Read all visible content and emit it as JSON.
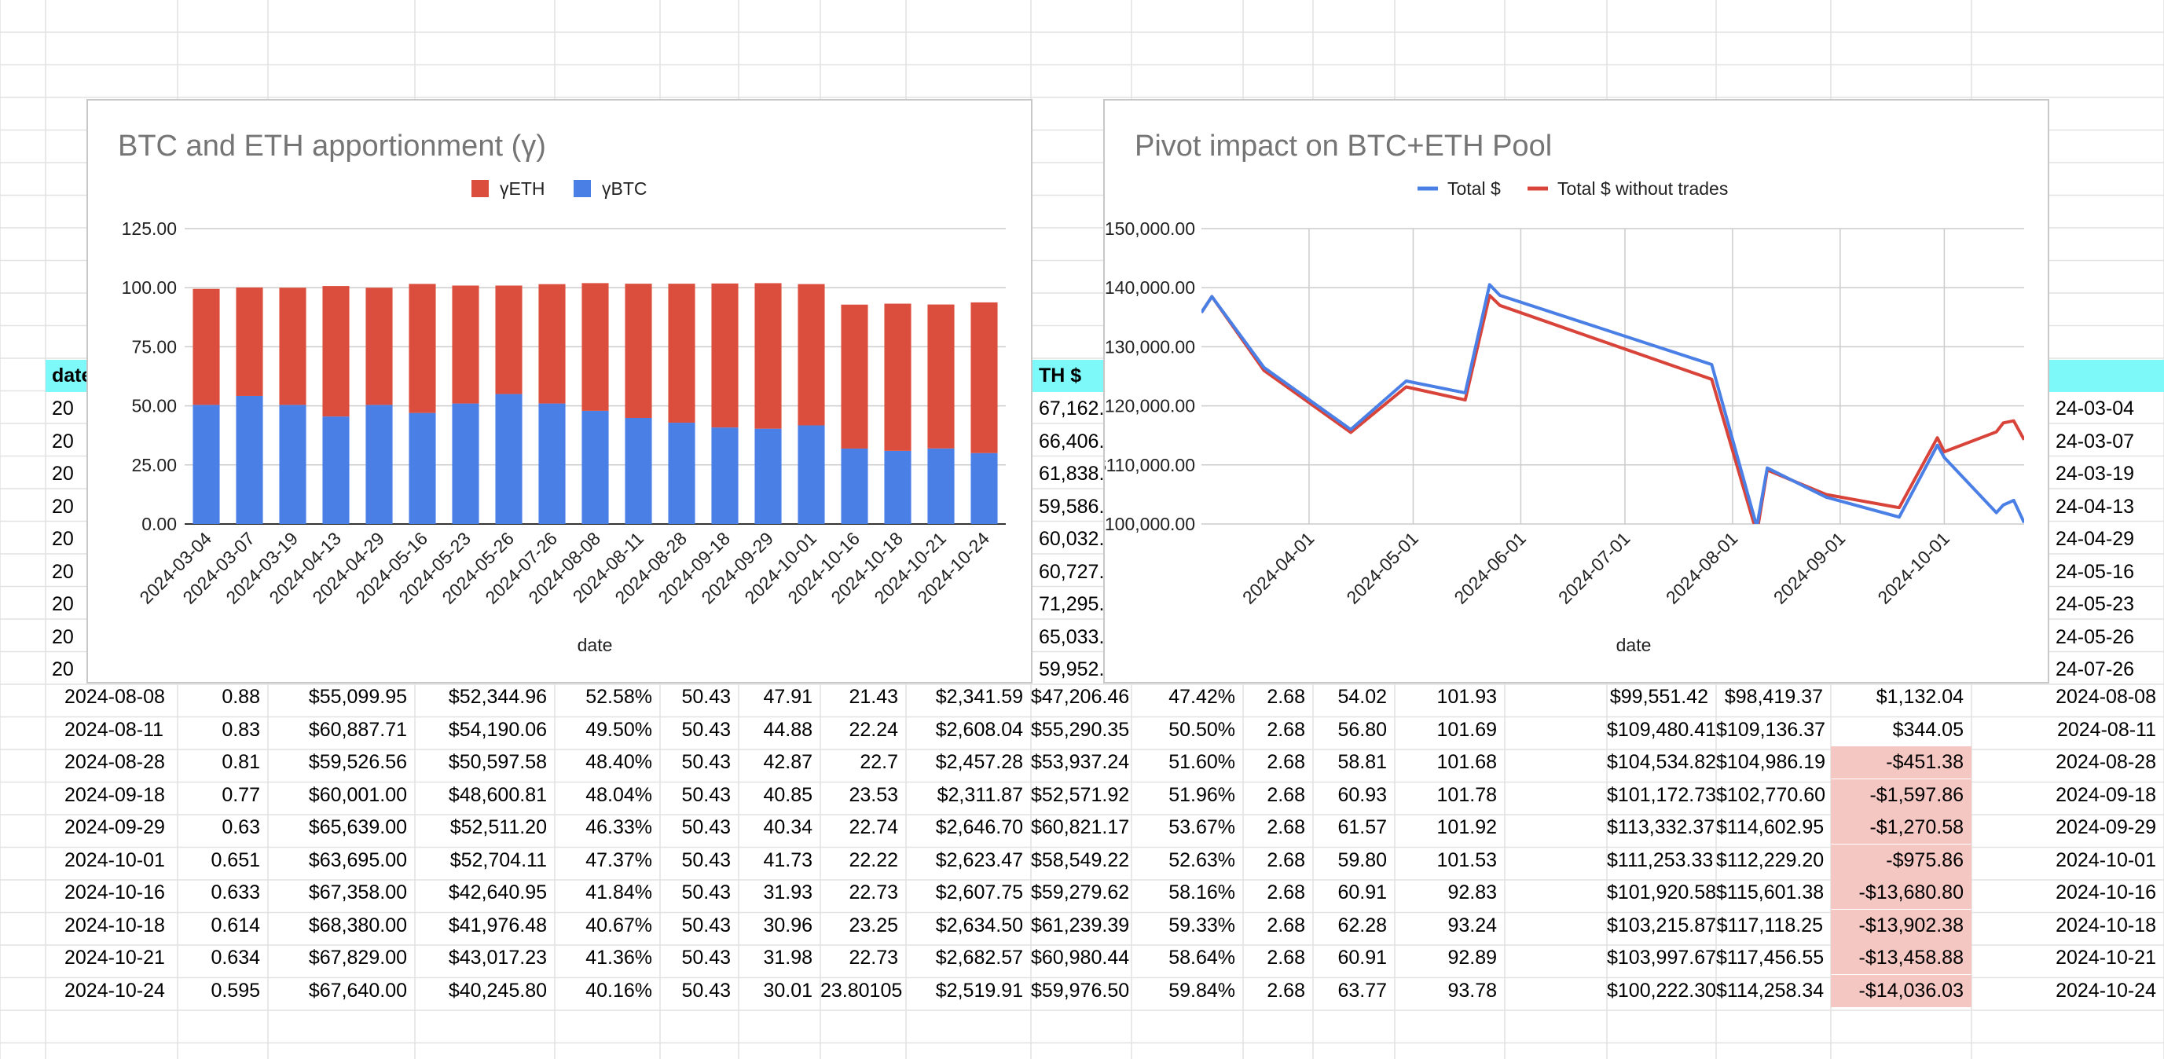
{
  "sheet": {
    "header_cells": {
      "date": "date",
      "eth_total": "TH $"
    },
    "left_col_fragment": "20",
    "eth_total_fragments": [
      "67,162.",
      "66,406.",
      "61,838.",
      "59,586.",
      "60,032.",
      "60,727.",
      "71,295.",
      "65,033.",
      "59,952."
    ],
    "right_dates_fragments": [
      "24-03-04",
      "24-03-07",
      "24-03-19",
      "24-04-13",
      "24-04-29",
      "24-05-16",
      "24-05-23",
      "24-05-26",
      "24-07-26"
    ],
    "rows": [
      [
        "2024-08-08",
        "0.88",
        "$55,099.95",
        "$52,344.96",
        "52.58%",
        "50.43",
        "47.91",
        "21.43",
        "$2,341.59",
        "$47,206.46",
        "47.42%",
        "2.68",
        "54.02",
        "101.93",
        "$99,551.42",
        "$98,419.37",
        "$1,132.04",
        "2024-08-08"
      ],
      [
        "2024-08-11",
        "0.83",
        "$60,887.71",
        "$54,190.06",
        "49.50%",
        "50.43",
        "44.88",
        "22.24",
        "$2,608.04",
        "$55,290.35",
        "50.50%",
        "2.68",
        "56.80",
        "101.69",
        "$109,480.41",
        "$109,136.37",
        "$344.05",
        "2024-08-11"
      ],
      [
        "2024-08-28",
        "0.81",
        "$59,526.56",
        "$50,597.58",
        "48.40%",
        "50.43",
        "42.87",
        "22.7",
        "$2,457.28",
        "$53,937.24",
        "51.60%",
        "2.68",
        "58.81",
        "101.68",
        "$104,534.82",
        "$104,986.19",
        "-$451.38",
        "2024-08-28"
      ],
      [
        "2024-09-18",
        "0.77",
        "$60,001.00",
        "$48,600.81",
        "48.04%",
        "50.43",
        "40.85",
        "23.53",
        "$2,311.87",
        "$52,571.92",
        "51.96%",
        "2.68",
        "60.93",
        "101.78",
        "$101,172.73",
        "$102,770.60",
        "-$1,597.86",
        "2024-09-18"
      ],
      [
        "2024-09-29",
        "0.63",
        "$65,639.00",
        "$52,511.20",
        "46.33%",
        "50.43",
        "40.34",
        "22.74",
        "$2,646.70",
        "$60,821.17",
        "53.67%",
        "2.68",
        "61.57",
        "101.92",
        "$113,332.37",
        "$114,602.95",
        "-$1,270.58",
        "2024-09-29"
      ],
      [
        "2024-10-01",
        "0.651",
        "$63,695.00",
        "$52,704.11",
        "47.37%",
        "50.43",
        "41.73",
        "22.22",
        "$2,623.47",
        "$58,549.22",
        "52.63%",
        "2.68",
        "59.80",
        "101.53",
        "$111,253.33",
        "$112,229.20",
        "-$975.86",
        "2024-10-01"
      ],
      [
        "2024-10-16",
        "0.633",
        "$67,358.00",
        "$42,640.95",
        "41.84%",
        "50.43",
        "31.93",
        "22.73",
        "$2,607.75",
        "$59,279.62",
        "58.16%",
        "2.68",
        "60.91",
        "92.83",
        "$101,920.58",
        "$115,601.38",
        "-$13,680.80",
        "2024-10-16"
      ],
      [
        "2024-10-18",
        "0.614",
        "$68,380.00",
        "$41,976.48",
        "40.67%",
        "50.43",
        "30.96",
        "23.25",
        "$2,634.50",
        "$61,239.39",
        "59.33%",
        "2.68",
        "62.28",
        "93.24",
        "$103,215.87",
        "$117,118.25",
        "-$13,902.38",
        "2024-10-18"
      ],
      [
        "2024-10-21",
        "0.634",
        "$67,829.00",
        "$43,017.23",
        "41.36%",
        "50.43",
        "31.98",
        "22.73",
        "$2,682.57",
        "$60,980.44",
        "58.64%",
        "2.68",
        "60.91",
        "92.89",
        "$103,997.67",
        "$117,456.55",
        "-$13,458.88",
        "2024-10-21"
      ],
      [
        "2024-10-24",
        "0.595",
        "$67,640.00",
        "$40,245.80",
        "40.16%",
        "50.43",
        "30.01",
        "23.80105",
        "$2,519.91",
        "$59,976.50",
        "59.84%",
        "2.68",
        "63.77",
        "93.78",
        "$100,222.30",
        "$114,258.34",
        "-$14,036.03",
        "2024-10-24"
      ]
    ],
    "colors": {
      "header_bg": "#7ef9f9",
      "negative_bg": "#f4c7c3",
      "grid_line": "#e2e2e2"
    }
  },
  "chart_data": [
    {
      "type": "bar",
      "stacked": true,
      "title": "BTC and ETH apportionment (γ)",
      "xlabel": "date",
      "ylabel": "",
      "ylim": [
        0,
        125
      ],
      "yticks": [
        "0.00",
        "25.00",
        "50.00",
        "75.00",
        "100.00",
        "125.00"
      ],
      "legend_position": "top",
      "categories": [
        "2024-03-04",
        "2024-03-07",
        "2024-03-19",
        "2024-04-13",
        "2024-04-29",
        "2024-05-16",
        "2024-05-23",
        "2024-05-26",
        "2024-07-26",
        "2024-08-08",
        "2024-08-11",
        "2024-08-28",
        "2024-09-18",
        "2024-09-29",
        "2024-10-01",
        "2024-10-16",
        "2024-10-18",
        "2024-10-21",
        "2024-10-24"
      ],
      "series": [
        {
          "name": "γBTC",
          "color": "#4a7fe6",
          "values": [
            50.4,
            54.2,
            50.4,
            45.5,
            50.4,
            47.0,
            51.0,
            55.0,
            51.0,
            47.91,
            44.88,
            42.87,
            40.85,
            40.34,
            41.73,
            31.93,
            30.96,
            31.98,
            30.01
          ]
        },
        {
          "name": "γETH",
          "color": "#db4d3c",
          "values": [
            49.1,
            45.9,
            49.6,
            55.2,
            49.6,
            54.6,
            49.9,
            45.9,
            50.5,
            54.02,
            56.8,
            58.81,
            60.93,
            61.57,
            59.8,
            60.91,
            62.28,
            60.91,
            63.77
          ]
        }
      ],
      "legend_order": [
        "γETH",
        "γBTC"
      ],
      "grid": true
    },
    {
      "type": "line",
      "title": "Pivot impact on BTC+ETH Pool",
      "xlabel": "date",
      "ylabel": "",
      "ylim": [
        100000,
        150000
      ],
      "yticks": [
        "$100,000.00",
        "$110,000.00",
        "$120,000.00",
        "$130,000.00",
        "$140,000.00",
        "$150,000.00"
      ],
      "xticks": [
        "2024-04-01",
        "2024-05-01",
        "2024-06-01",
        "2024-07-01",
        "2024-08-01",
        "2024-09-01",
        "2024-10-01"
      ],
      "xrange": [
        "2024-03-01",
        "2024-10-24"
      ],
      "legend_position": "top",
      "grid": true,
      "x": [
        "2024-03-01",
        "2024-03-04",
        "2024-03-19",
        "2024-04-13",
        "2024-04-29",
        "2024-05-16",
        "2024-05-23",
        "2024-05-26",
        "2024-07-26",
        "2024-08-08",
        "2024-08-11",
        "2024-08-28",
        "2024-09-18",
        "2024-09-29",
        "2024-10-01",
        "2024-10-16",
        "2024-10-18",
        "2024-10-21",
        "2024-10-24"
      ],
      "series": [
        {
          "name": "Total $",
          "color": "#4a7fe6",
          "values": [
            135800,
            138500,
            126500,
            116000,
            124200,
            122200,
            140500,
            138700,
            127000,
            99551.42,
            109480.41,
            104534.82,
            101172.73,
            113332.37,
            111253.33,
            101920.58,
            103215.87,
            103997.67,
            100222.3
          ]
        },
        {
          "name": "Total $ without trades",
          "color": "#d8433a",
          "values": [
            135800,
            138500,
            126000,
            115500,
            123200,
            121000,
            138700,
            137000,
            124500,
            98419.37,
            109136.37,
            104986.19,
            102770.6,
            114602.95,
            112229.2,
            115601.38,
            117118.25,
            117456.55,
            114258.34
          ]
        }
      ]
    }
  ]
}
